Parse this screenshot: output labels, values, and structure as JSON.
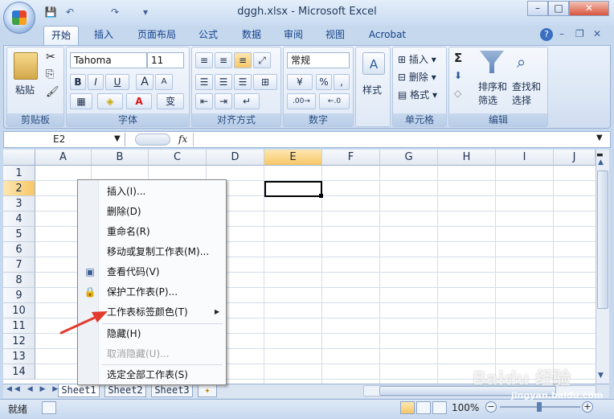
{
  "window": {
    "title": "dggh.xlsx - Microsoft Excel",
    "minimize": "–",
    "maximize": "□",
    "close": "✕"
  },
  "qat": {
    "save": "💾",
    "undo": "↶",
    "redo": "↷",
    "more": "▾"
  },
  "tabs": [
    "开始",
    "插入",
    "页面布局",
    "公式",
    "数据",
    "审阅",
    "视图",
    "Acrobat"
  ],
  "tab_right": {
    "help": "?",
    "min": "–",
    "restore": "❐",
    "close": "✕"
  },
  "ribbon": {
    "clipboard": {
      "label": "剪贴板",
      "paste": "粘贴"
    },
    "font": {
      "label": "字体",
      "name": "Tahoma",
      "size": "11",
      "bold": "B",
      "italic": "I",
      "underline": "U",
      "grow": "A",
      "shrink": "A",
      "wen": "变"
    },
    "alignment": {
      "label": "对齐方式"
    },
    "number": {
      "label": "数字",
      "format": "常规",
      "pct": "%",
      "comma": ",",
      "inc": ".00→",
      "dec": "←.0"
    },
    "styles": {
      "label": "样式"
    },
    "cells": {
      "label": "单元格",
      "insert": "插入",
      "delete": "删除",
      "format": "格式"
    },
    "editing": {
      "label": "编辑",
      "sum": "Σ",
      "sort": "排序和",
      "sort2": "筛选",
      "find": "查找和",
      "find2": "选择"
    }
  },
  "formula": {
    "name_box": "E2",
    "fx": "fx",
    "value": ""
  },
  "columns": [
    "A",
    "B",
    "C",
    "D",
    "E",
    "F",
    "G",
    "H",
    "I",
    "J"
  ],
  "rows": [
    "1",
    "2",
    "3",
    "4",
    "5",
    "6",
    "7",
    "8",
    "9",
    "10",
    "11",
    "12",
    "13",
    "14"
  ],
  "active_cell": "E2",
  "context_menu": [
    {
      "label": "插入(I)...",
      "enabled": true
    },
    {
      "label": "删除(D)",
      "enabled": true
    },
    {
      "label": "重命名(R)",
      "enabled": true
    },
    {
      "label": "移动或复制工作表(M)...",
      "enabled": true
    },
    {
      "label": "查看代码(V)",
      "enabled": true
    },
    {
      "label": "保护工作表(P)...",
      "enabled": true
    },
    {
      "label": "工作表标签颜色(T)",
      "enabled": true,
      "submenu": "▶"
    },
    {
      "label": "隐藏(H)",
      "enabled": true
    },
    {
      "label": "取消隐藏(U)...",
      "enabled": false
    },
    {
      "label": "选定全部工作表(S)",
      "enabled": true
    }
  ],
  "sheets": [
    "Sheet1",
    "Sheet2",
    "Sheet3"
  ],
  "status": {
    "mode": "就绪",
    "zoom": "100%"
  },
  "watermark": {
    "brand": "Baidu 经验",
    "site": "jingyan.baidu.com"
  },
  "colors": {
    "accent": "#15428b",
    "selected_header": "#f8c767",
    "arrow": "#e23b2e"
  }
}
